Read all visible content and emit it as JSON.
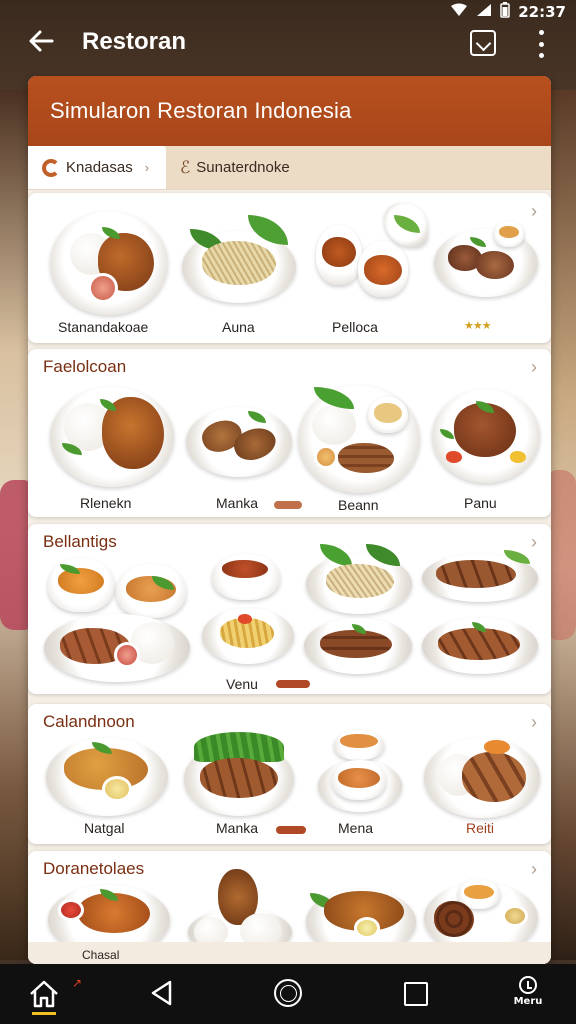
{
  "status_bar": {
    "time": "22:37"
  },
  "app_bar": {
    "title": "Restoran"
  },
  "card": {
    "title": "Simularon Restoran Indonesia"
  },
  "tabs": [
    {
      "label": "Knadasas"
    },
    {
      "label": "Sunaterdnoke"
    }
  ],
  "sections": [
    {
      "title": "",
      "items": [
        "Stanandakoae",
        "Auna",
        "Pelloca",
        ""
      ],
      "rating": "★★★"
    },
    {
      "title": "Faelolcoan",
      "items": [
        "Rlenekn",
        "Manka",
        "Beann",
        "Panu"
      ]
    },
    {
      "title": "Bellantigs",
      "items": [
        "Venu"
      ]
    },
    {
      "title": "Calandnoon",
      "items": [
        "Natgal",
        "Manka",
        "Mena",
        "Reiti"
      ]
    },
    {
      "title": "Doranetolaes",
      "items": [
        "Chasal"
      ]
    }
  ],
  "nav_bar": {
    "menu_label": "Meru"
  },
  "colors": {
    "header": "#a8461a",
    "section_title": "#7a2e12",
    "card_bg": "#f5efe6"
  }
}
